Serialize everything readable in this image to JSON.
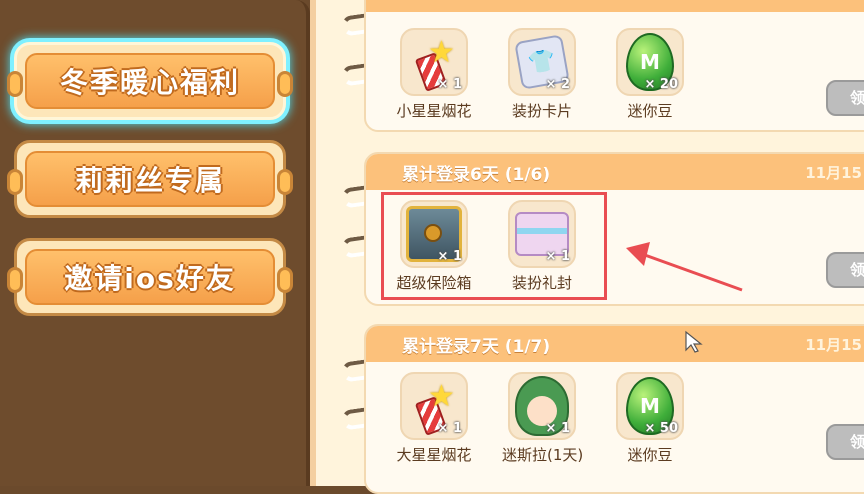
{
  "sidebar": {
    "tabs": [
      {
        "label": "冬季暖心福利",
        "active": true
      },
      {
        "label": "莉莉丝专属",
        "active": false
      },
      {
        "label": "邀请ios好友",
        "active": false
      }
    ]
  },
  "rewards": {
    "row_top": {
      "items": [
        {
          "name": "小星星烟花",
          "qty": "× 1",
          "icon": "small-firework-icon"
        },
        {
          "name": "装扮卡片",
          "qty": "× 2",
          "icon": "outfit-card-icon"
        },
        {
          "name": "迷你豆",
          "qty": "× 20",
          "icon": "mini-bean-egg-icon"
        }
      ],
      "claim_label": "领"
    },
    "day6": {
      "title": "累计登录6天 (1/6)",
      "date": "11月15",
      "items": [
        {
          "name": "超级保险箱",
          "qty": "× 1",
          "icon": "super-safe-icon"
        },
        {
          "name": "装扮礼封",
          "qty": "× 1",
          "icon": "outfit-envelope-icon"
        }
      ],
      "claim_label": "领"
    },
    "day7": {
      "title": "累计登录7天 (1/7)",
      "date": "11月15",
      "items": [
        {
          "name": "大星星烟花",
          "qty": "× 1",
          "icon": "big-firework-icon"
        },
        {
          "name": "迷斯拉(1天)",
          "qty": "× 1",
          "icon": "misra-dino-icon"
        },
        {
          "name": "迷你豆",
          "qty": "× 50",
          "icon": "mini-bean-egg-icon"
        }
      ],
      "claim_label": "领"
    }
  },
  "colors": {
    "highlight": "#e94d52",
    "tab_glow": "#4ddcf0",
    "header": "#fcc17b"
  }
}
